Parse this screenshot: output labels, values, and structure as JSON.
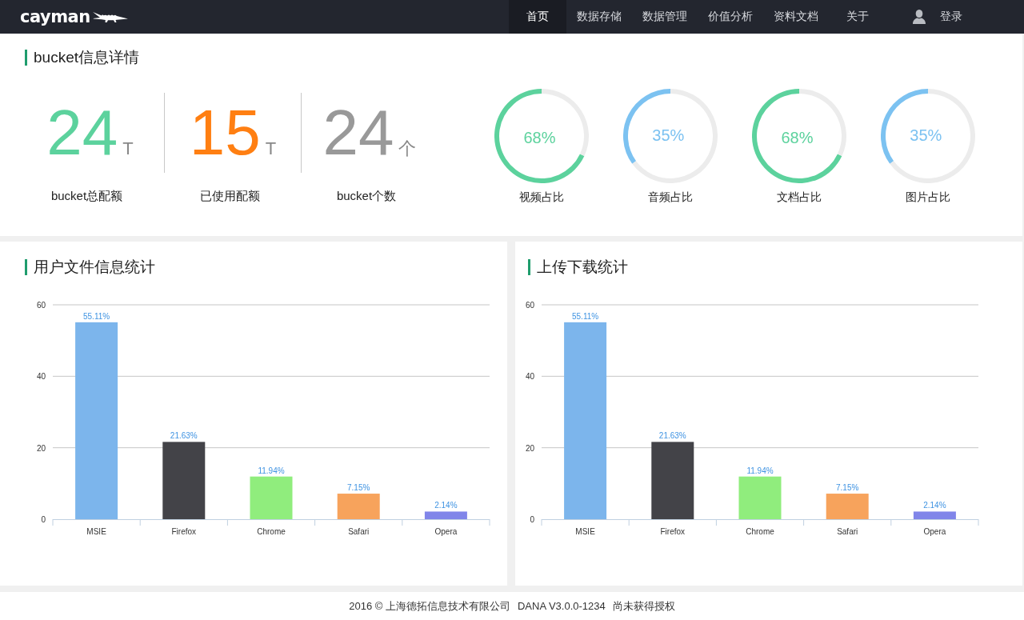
{
  "header": {
    "logo": "cayman",
    "nav": [
      {
        "label": "首页",
        "selected": true
      },
      {
        "label": "数据存储",
        "selected": false
      },
      {
        "label": "数据管理",
        "selected": false
      },
      {
        "label": "价值分析",
        "selected": false
      },
      {
        "label": "资料文档",
        "selected": false
      },
      {
        "label": "关于",
        "selected": false
      }
    ],
    "login": "登录"
  },
  "bucket_panel": {
    "title": "bucket信息详情",
    "stats": [
      {
        "value": "24",
        "unit": "T",
        "label": "bucket总配额",
        "color": "#5cd29d"
      },
      {
        "value": "15",
        "unit": "T",
        "label": "已使用配额",
        "color": "#ff7f12"
      },
      {
        "value": "24",
        "unit": "个",
        "label": "bucket个数",
        "color": "#999999"
      }
    ],
    "rings": [
      {
        "label": "视频占比",
        "chart_data": {
          "type": "donut",
          "values": [
            68,
            32
          ],
          "colors": [
            "#5cd29d",
            "#ececec"
          ],
          "value_labels": [
            "68%",
            null
          ]
        }
      },
      {
        "label": "音频占比",
        "chart_data": {
          "type": "donut",
          "values": [
            35,
            65
          ],
          "colors": [
            "#7cc2f1",
            "#ececec"
          ],
          "value_labels": [
            "35%",
            null
          ]
        }
      },
      {
        "label": "文档占比",
        "chart_data": {
          "type": "donut",
          "values": [
            68,
            32
          ],
          "colors": [
            "#5cd29d",
            "#ececec"
          ],
          "value_labels": [
            "68%",
            null
          ]
        }
      },
      {
        "label": "图片占比",
        "chart_data": {
          "type": "donut",
          "values": [
            35,
            65
          ],
          "colors": [
            "#7cc2f1",
            "#ececec"
          ],
          "value_labels": [
            "35%",
            null
          ]
        }
      }
    ]
  },
  "charts": [
    {
      "title": "用户文件信息统计",
      "chart_data": {
        "type": "bar",
        "categories": [
          "MSIE",
          "Firefox",
          "Chrome",
          "Safari",
          "Opera"
        ],
        "values": [
          55.11,
          21.63,
          11.94,
          7.15,
          2.14
        ],
        "colors": [
          "#7cb5ec",
          "#434348",
          "#90ed7d",
          "#f7a35c",
          "#8085e9"
        ],
        "ylim": [
          0,
          60
        ],
        "yticks": [
          0,
          20,
          40,
          60
        ],
        "grid": true,
        "value_labels": [
          "55.11%",
          "21.63%",
          "11.94%",
          "7.15%",
          "2.14%"
        ]
      }
    },
    {
      "title": "上传下载统计",
      "chart_data": {
        "type": "bar",
        "categories": [
          "MSIE",
          "Firefox",
          "Chrome",
          "Safari",
          "Opera"
        ],
        "values": [
          55.11,
          21.63,
          11.94,
          7.15,
          2.14
        ],
        "colors": [
          "#7cb5ec",
          "#434348",
          "#90ed7d",
          "#f7a35c",
          "#8085e9"
        ],
        "ylim": [
          0,
          60
        ],
        "yticks": [
          0,
          20,
          40,
          60
        ],
        "grid": true,
        "value_labels": [
          "55.11%",
          "21.63%",
          "11.94%",
          "7.15%",
          "2.14%"
        ]
      }
    }
  ],
  "footer": [
    "2016 © 上海德拓信息技术有限公司",
    "DANA V3.0.0-1234",
    "尚未获得授权"
  ]
}
